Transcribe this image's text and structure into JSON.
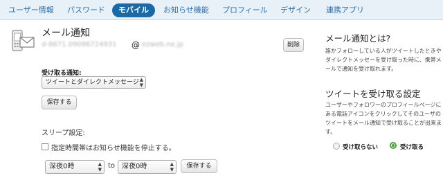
{
  "tabs": [
    {
      "label": "ユーザー情報"
    },
    {
      "label": "パスワード"
    },
    {
      "label": "モバイル"
    },
    {
      "label": "お知らせ機能"
    },
    {
      "label": "プロフィール"
    },
    {
      "label": "デザイン"
    },
    {
      "label": "連携アプリ"
    }
  ],
  "active_tab": "モバイル",
  "email_section": {
    "title": "メール通知",
    "address_local": "d-8671.09096724931",
    "at": "@",
    "address_domain": "ezweb.ne.jp",
    "delete_label": "削除"
  },
  "receive": {
    "label": "受け取る通知:",
    "selected": "ツイートとダイレクトメッセージ",
    "save_label": "保存する"
  },
  "sleep": {
    "label": "スリープ設定:",
    "checkbox_label": "指定時間帯はお知らせ機能を停止する。",
    "checked": false,
    "from": "深夜0時",
    "to_word": "to",
    "to": "深夜0時",
    "save_label": "保存する"
  },
  "sidebar": {
    "heading1": "メール通知とは?",
    "text1": "誰かフォローしている人がツイートしたときやダイレクトメッセーを受け取った時に、携帯メールで通知を受け取れます。",
    "heading2": "ツイートを受け取る設定",
    "text2": "ユーザーやフォロワーのプロフィールページにある電話アイコンをクリックしてそのユーザのツイートをメール通知で受け取ることが出来ます。",
    "option_off": "受け取らない",
    "option_on": "受け取る",
    "selected_option": "受け取る"
  },
  "colors": {
    "accent": "#1b6aa5",
    "tab_text": "#2d6fa7",
    "tabbar_bg": "#e8f1f8",
    "radio_on": "#4aa03a"
  },
  "icons": [
    "mobile-mail-icon",
    "select-arrows-icon",
    "radio-off-icon",
    "radio-on-icon"
  ]
}
